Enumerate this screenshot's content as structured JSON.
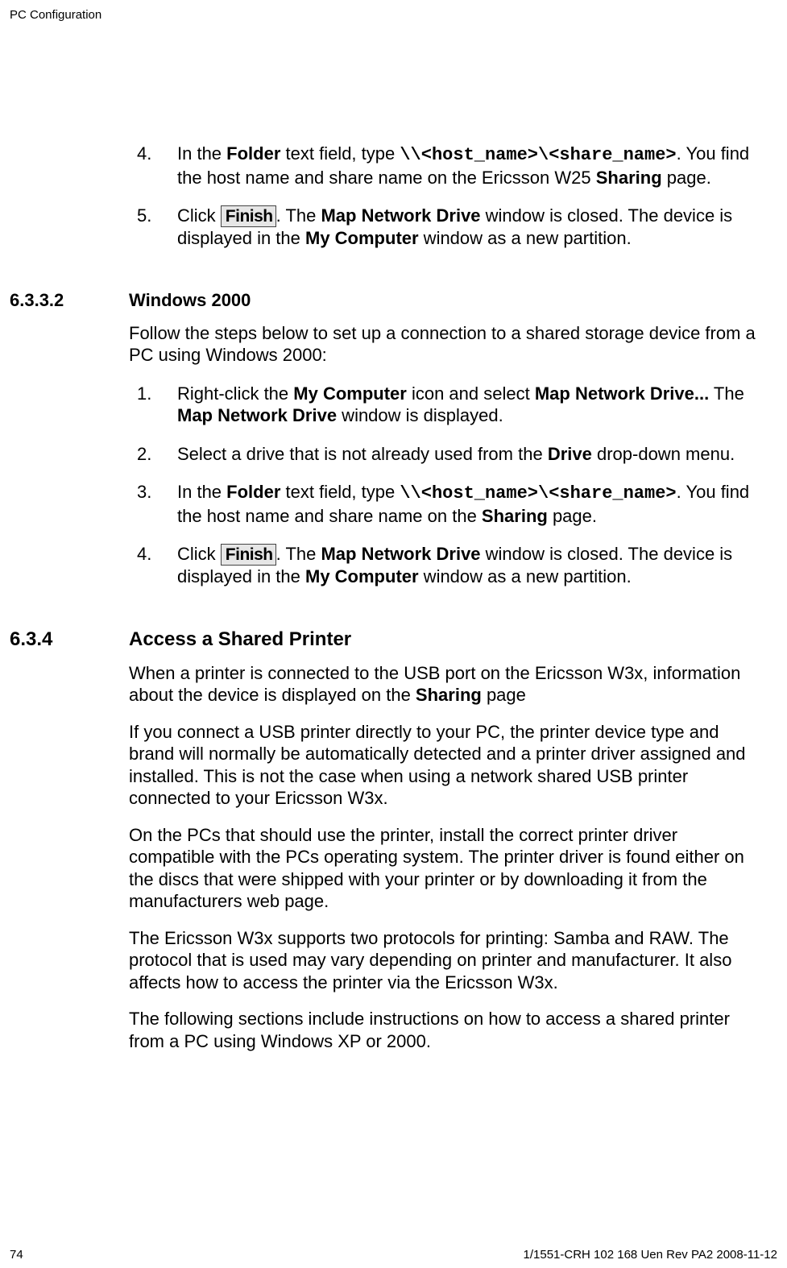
{
  "header": "PC Configuration",
  "stepsA": {
    "item4": {
      "pre": "In the ",
      "b1": "Folder",
      "mid1": " text field, type ",
      "code": "\\\\<host_name>\\<share_name>",
      "mid2": ". You find the host name and share name on the Ericsson W25 ",
      "b2": "Sharing",
      "mid3": " page."
    },
    "item5": {
      "pre": "Click ",
      "btn": " Finish ",
      "mid1": ". The ",
      "b1": "Map Network Drive",
      "mid2": " window is closed. The device is displayed in the ",
      "b2": "My Computer",
      "mid3": " window as a new partition."
    }
  },
  "sec6332": {
    "num": "6.3.3.2",
    "title": "Windows 2000",
    "intro": "Follow the steps below to set up a connection to a shared storage device from a PC using Windows 2000:",
    "item1": {
      "pre": "Right-click the ",
      "b1": "My Computer",
      "mid1": " icon and select ",
      "b2": "Map Network Drive...",
      "mid2": " The ",
      "b3": "Map Network Drive",
      "mid3": " window is displayed."
    },
    "item2": {
      "pre": "Select a drive that is not already used from the ",
      "b1": "Drive",
      "mid1": " drop-down menu."
    },
    "item3": {
      "pre": "In the ",
      "b1": "Folder",
      "mid1": " text field, type ",
      "code": "\\\\<host_name>\\<share_name>",
      "mid2": ". You find the host name and share name on the ",
      "b2": "Sharing",
      "mid3": " page."
    },
    "item4": {
      "pre": "Click ",
      "btn": " Finish ",
      "mid1": ". The ",
      "b1": "Map Network Drive",
      "mid2": " window is closed. The device is displayed in the ",
      "b2": "My Computer",
      "mid3": " window as a new partition."
    }
  },
  "sec634": {
    "num": "6.3.4",
    "title": "Access a Shared Printer",
    "p1a": "When a printer is connected to the USB port on the Ericsson W3x, information about the device is displayed on the ",
    "p1b": "Sharing",
    "p1c": " page",
    "p2": "If you connect a USB printer directly to your PC, the printer device type and brand will normally be automatically detected and a printer driver assigned and installed. This is not the case when using a network shared USB printer connected to your Ericsson W3x.",
    "p3": "On the PCs that should use the printer, install the correct printer driver compatible with the PCs operating system. The printer driver is found either on the discs that were shipped with your printer or by downloading it from the manufacturers web page.",
    "p4": "The Ericsson W3x supports two protocols for printing: Samba and RAW. The protocol that is used may vary depending on printer and manufacturer. It also affects how to access the printer via the Ericsson W3x.",
    "p5": "The following sections include instructions on how to access a shared printer from a PC using Windows XP or 2000."
  },
  "footer": {
    "pageNum": "74",
    "docRef": "1/1551-CRH 102 168 Uen Rev PA2  2008-11-12"
  }
}
